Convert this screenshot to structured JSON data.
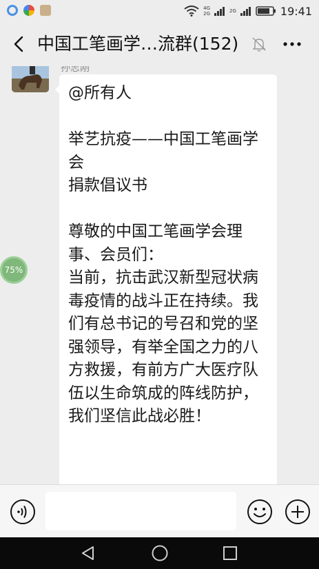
{
  "status_bar": {
    "time": "19:41",
    "network_1": "4G",
    "network_2": "2G",
    "network_3": "2G",
    "wifi_icon": "wifi-icon",
    "battery_icon": "battery-icon"
  },
  "header": {
    "title": "中国工笔画学…流群(152)",
    "back_icon": "back-arrow-icon",
    "mute_icon": "muted-bell-icon",
    "more_icon": "more-dots-icon"
  },
  "message": {
    "sender_name": "孙志刚",
    "text": "@所有人\n\n举艺抗疫——中国工笔画学会\n捐款倡议书\n\n尊敬的中国工笔画学会理事、会员们：\n当前，抗击武汉新型冠状病毒疫情的战斗正在持续。我们有总书记的号召和党的坚强领导，有举全国之力的八方救援，有前方广大医疗队伍以生命筑成的阵线防护，我们坚信此战必胜！"
  },
  "floating_badge": {
    "label": "75%"
  },
  "input_bar": {
    "voice_icon": "voice-icon",
    "input_value": "",
    "emoji_icon": "emoji-icon",
    "plus_icon": "plus-icon"
  },
  "nav_bar": {
    "back_icon": "nav-back-icon",
    "home_icon": "nav-home-icon",
    "recent_icon": "nav-recent-icon"
  }
}
